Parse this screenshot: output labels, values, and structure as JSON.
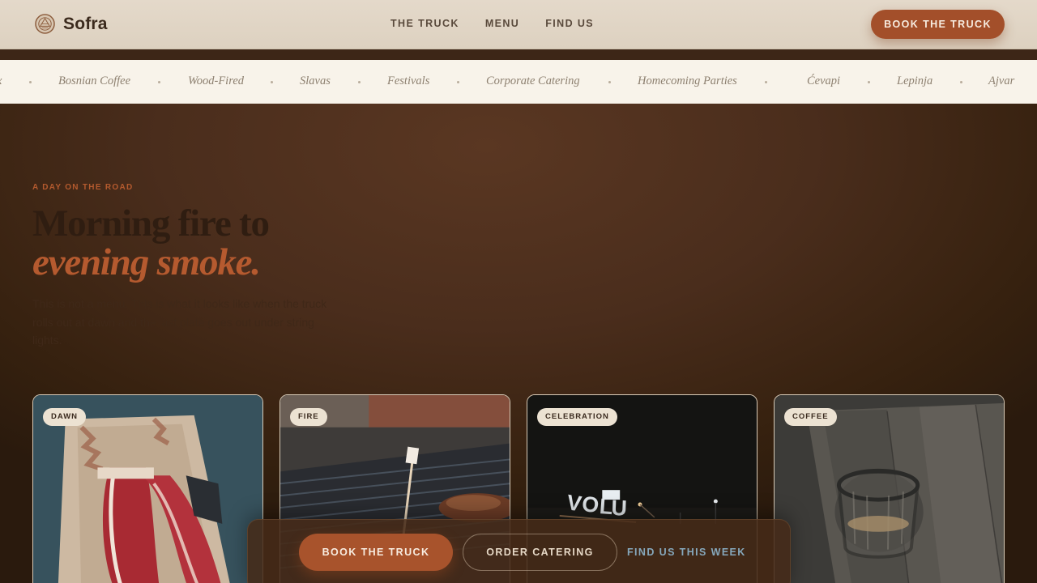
{
  "header": {
    "brand": "Sofra",
    "nav": [
      "THE TRUCK",
      "MENU",
      "FIND US"
    ],
    "cta": "BOOK THE TRUCK"
  },
  "ticker": {
    "leading_fragment": "x",
    "items": [
      "Bosnian Coffee",
      "Wood-Fired",
      "Slavas",
      "Festivals",
      "Corporate Catering",
      "Homecoming Parties",
      "Ćevapi",
      "Lepinja",
      "Ajvar"
    ]
  },
  "hero": {
    "eyebrow": "A DAY ON THE ROAD",
    "title_line1": "Morning fire to",
    "title_line2": "evening smoke.",
    "body": "This is not a menu. This is what it looks like when the truck rolls out at dawn and the last plate goes out under string lights."
  },
  "cards": [
    {
      "tag": "DAWN",
      "image": "raw-meat-on-butcher-paper"
    },
    {
      "tag": "FIRE",
      "image": "skewer-over-grill"
    },
    {
      "tag": "CELEBRATION",
      "image": "night-volume-sign"
    },
    {
      "tag": "COFFEE",
      "image": "coffee-glass-on-wood"
    }
  ],
  "action_bar": {
    "primary": "BOOK THE TRUCK",
    "secondary": "ORDER CATERING",
    "link": "FIND US THIS WEEK"
  },
  "colors": {
    "accent": "#a8532c",
    "header_bg": "#e2d7c7",
    "ticker_bg": "#f8f3ea",
    "page_bg": "#4a2d1c",
    "link_blue": "#86a8bc"
  }
}
